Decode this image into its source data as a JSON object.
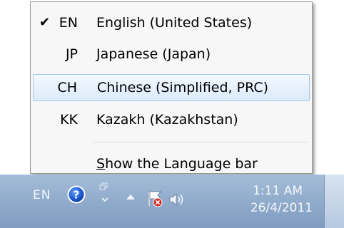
{
  "language_menu": {
    "items": [
      {
        "code": "EN",
        "label": "English (United States)",
        "checked": true,
        "highlighted": false
      },
      {
        "code": "JP",
        "label": "Japanese (Japan)",
        "checked": false,
        "highlighted": false
      },
      {
        "code": "CH",
        "label": "Chinese (Simplified, PRC)",
        "checked": false,
        "highlighted": true
      },
      {
        "code": "KK",
        "label": "Kazakh (Kazakhstan)",
        "checked": false,
        "highlighted": false
      }
    ],
    "show_language_bar_label": "Show the Language bar",
    "check_glyph": "✔"
  },
  "taskbar": {
    "language_indicator": "EN",
    "clock_time": "1:11 AM",
    "clock_date": "26/4/2011",
    "icons": {
      "help": "help-icon",
      "options": "options-icon",
      "tray_overflow": "chevron-up-icon",
      "action_center": "flag-icon",
      "volume": "volume-icon"
    }
  },
  "colors": {
    "menu_bg": "#f7f7f7",
    "selection_border": "#a6c8ef",
    "taskbar_top": "#a3bcd8",
    "taskbar_bottom": "#7f9bbf"
  }
}
